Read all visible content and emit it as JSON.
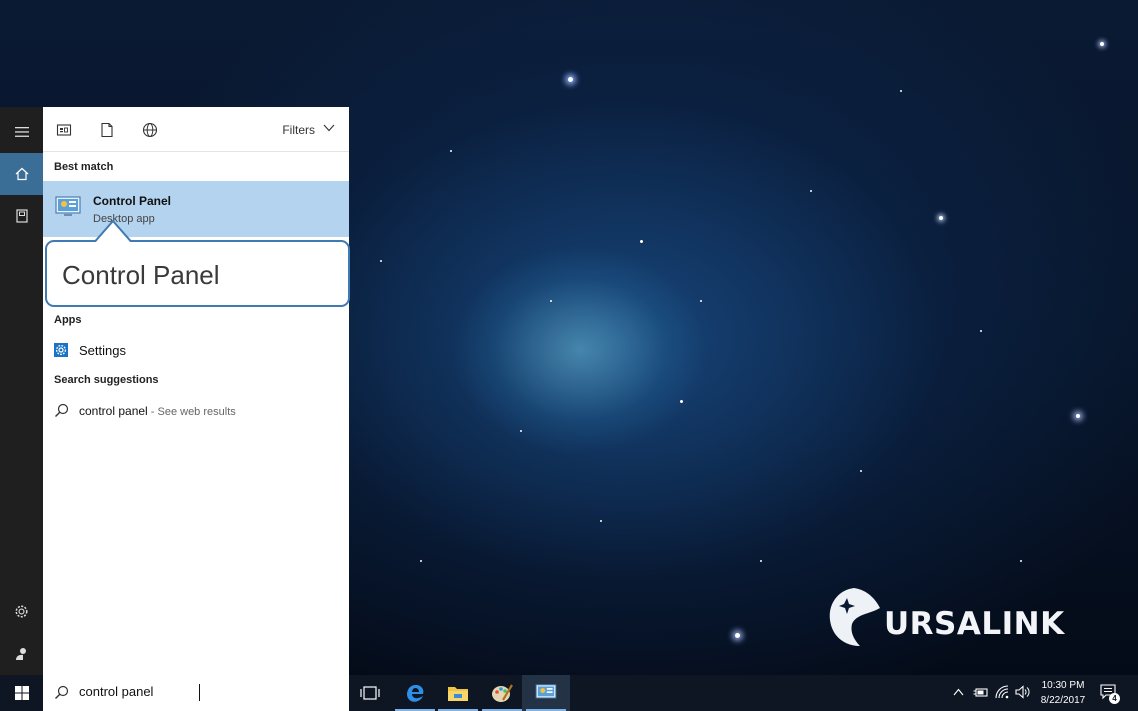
{
  "start_menu": {
    "filters_label": "Filters",
    "best_match_heading": "Best match",
    "best_match": {
      "title": "Control Panel",
      "subtitle": "Desktop app"
    },
    "callout_text": "Control Panel",
    "apps_heading": "Apps",
    "apps": [
      {
        "label": "Settings"
      }
    ],
    "suggestions_heading": "Search suggestions",
    "suggestions": [
      {
        "query": "control panel",
        "hint": " - See web results"
      }
    ]
  },
  "taskbar": {
    "search_value": "control panel",
    "clock": {
      "time": "10:30 PM",
      "date": "8/22/2017"
    },
    "notification_count": "4"
  },
  "watermark": {
    "brand": "URSALINK"
  },
  "colors": {
    "accent": "#3b6e97",
    "highlight": "#b4d3ef",
    "callout_border": "#3f7ab3"
  },
  "icons": {
    "rail": [
      "hamburger-icon",
      "home-icon",
      "documents-icon",
      "settings-gear-icon",
      "user-icon"
    ],
    "filters": [
      "apps-filter-icon",
      "documents-filter-icon",
      "web-filter-icon"
    ],
    "taskbar": [
      "task-view-icon",
      "edge-icon",
      "file-explorer-icon",
      "paint-icon",
      "control-panel-icon"
    ],
    "tray": [
      "chevron-up-icon",
      "power-icon",
      "wifi-icon",
      "volume-icon",
      "action-center-icon"
    ]
  }
}
